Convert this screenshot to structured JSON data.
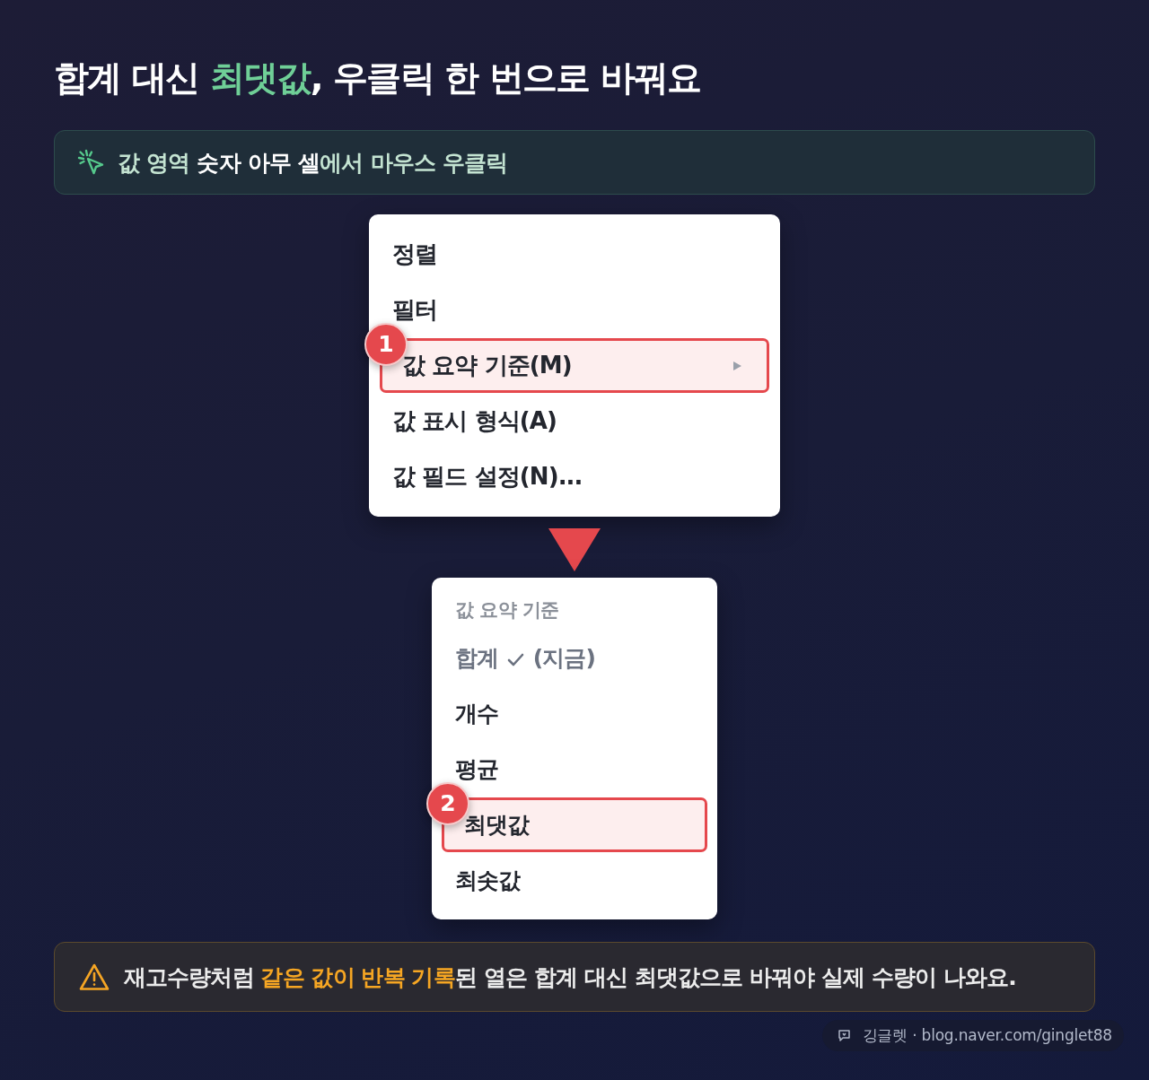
{
  "title": [
    {
      "text": "합계 대신 ",
      "highlight": false
    },
    {
      "text": "최댓값",
      "highlight": true
    },
    {
      "text": ", 우클릭 한 번으로 바꿔요",
      "highlight": false
    }
  ],
  "hint": {
    "text": "값 영역 **숫자 아무 셀**에서 마우스 우클릭"
  },
  "context_menu": {
    "items": [
      {
        "label": "정렬",
        "selected": false,
        "submenu": false
      },
      {
        "label": "필터",
        "selected": false,
        "submenu": false
      },
      {
        "label": "값 요약 기준(M)",
        "selected": true,
        "submenu": true,
        "step": "1"
      },
      {
        "label": "값 표시 형식(A)",
        "selected": false,
        "submenu": false
      },
      {
        "label": "값 필드 설정(N)...",
        "selected": false,
        "submenu": false
      }
    ]
  },
  "submenu": {
    "header": "값 요약 기준",
    "items": [
      {
        "label": "합계",
        "checked": true,
        "note": "(지금)",
        "selected": false
      },
      {
        "label": "개수",
        "checked": false,
        "selected": false
      },
      {
        "label": "평균",
        "checked": false,
        "selected": false
      },
      {
        "label": "최댓값",
        "checked": false,
        "selected": true,
        "step": "2"
      },
      {
        "label": "최솟값",
        "checked": false,
        "selected": false
      }
    ]
  },
  "warning": {
    "segments": [
      {
        "text": "재고수량처럼 ",
        "highlight": false
      },
      {
        "text": "같은 값이 반복 기록",
        "highlight": true
      },
      {
        "text": "된 열은 합계 대신 최댓값으로 바꿔야 실제 수량이 나와요.",
        "highlight": false
      }
    ]
  },
  "credit": {
    "text": "깅글렛 · blog.naver.com/ginglet88"
  }
}
